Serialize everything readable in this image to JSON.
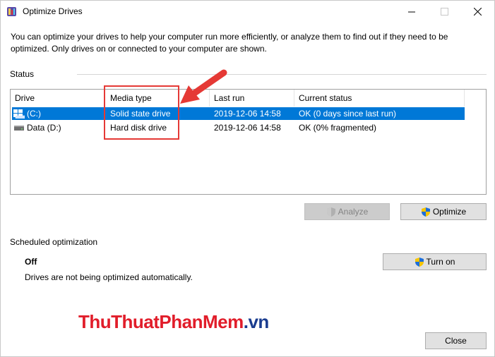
{
  "window": {
    "title": "Optimize Drives"
  },
  "intro": {
    "text": "You can optimize your drives to help your computer run more efficiently, or analyze them to find out if they need to be optimized. Only drives on or connected to your computer are shown."
  },
  "status": {
    "label": "Status",
    "columns": [
      "Drive",
      "Media type",
      "Last run",
      "Current status"
    ],
    "drives": [
      {
        "drive": "(C:)",
        "media_type": "Solid state drive",
        "last_run": "2019-12-06 14:58",
        "current_status": "OK (0 days since last run)",
        "icon": "windows-drive-icon",
        "selected": true
      },
      {
        "drive": "Data (D:)",
        "media_type": "Hard disk drive",
        "last_run": "2019-12-06 14:58",
        "current_status": "OK (0% fragmented)",
        "icon": "hard-disk-icon",
        "selected": false
      }
    ],
    "analyze_label": "Analyze",
    "optimize_label": "Optimize"
  },
  "scheduled": {
    "label": "Scheduled optimization",
    "state": "Off",
    "description": "Drives are not being optimized automatically.",
    "turn_on_label": "Turn on"
  },
  "footer": {
    "close_label": "Close"
  },
  "watermark": {
    "text": "ThuThuatPhanMem.vn",
    "parts": [
      "Thu",
      "Thuat",
      "PhanMem",
      ".vn"
    ]
  },
  "colors": {
    "selection": "#0078d7",
    "annotation": "#e53935",
    "watermark_red": "#e11d2a",
    "watermark_blue": "#1a3c8f"
  }
}
